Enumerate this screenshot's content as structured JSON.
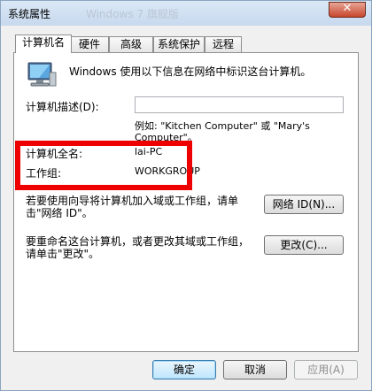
{
  "window": {
    "title": "系统属性",
    "title_ghost": "Windows 7 旗舰版",
    "close_glyph": "✕"
  },
  "tabs": [
    {
      "label": "计算机名",
      "active": true
    },
    {
      "label": "硬件",
      "active": false
    },
    {
      "label": "高级",
      "active": false
    },
    {
      "label": "系统保护",
      "active": false
    },
    {
      "label": "远程",
      "active": false
    }
  ],
  "panel": {
    "intro": "Windows 使用以下信息在网络中标识这台计算机。",
    "desc_label": "计算机描述(D):",
    "desc_value": "",
    "example_line1": "例如: \"Kitchen Computer\" 或 \"Mary's",
    "example_line2": "Computer\"。",
    "full_name_label": "计算机全名:",
    "full_name_value": "lai-PC",
    "workgroup_label": "工作组:",
    "workgroup_value": "WORKGROUP",
    "network_text_line1": "若要使用向导将计算机加入域或工作组，请单",
    "network_text_line2": "击\"网络 ID\"。",
    "network_id_button": "网络 ID(N)...",
    "rename_text_line1": "要重命名这台计算机，或者更改其域或工作组，",
    "rename_text_line2": "请单击\"更改\"。",
    "change_button": "更改(C)..."
  },
  "footer": {
    "ok": "确定",
    "cancel": "取消",
    "apply": "应用(A)"
  },
  "icons": {
    "computer": "computer-monitor-icon"
  },
  "colors": {
    "highlight_box": "#ee0000"
  }
}
